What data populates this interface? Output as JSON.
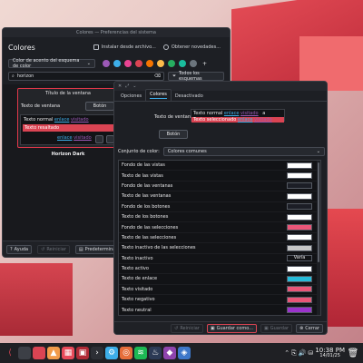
{
  "back_window": {
    "titlebar": "Colores — Preferencias del sistema",
    "title": "Colores",
    "install_label": "Instalar desde archivo...",
    "get_new_label": "Obtener novedades...",
    "accent_combo": "Color de acento del esquema de color",
    "accent_colors": [
      "#9b59b6",
      "#3daee9",
      "#e84393",
      "#da4453",
      "#f67400",
      "#fdbc4b",
      "#27ae60",
      "#1abc9c",
      "#6c757d"
    ],
    "search_value": "horizon",
    "filter_label": "Todos los esquemas",
    "preview": {
      "title": "Título de la ventana",
      "label": "Texto de ventana",
      "button": "Botón",
      "normal_text": "Texto normal",
      "link_text": "enlace",
      "visited_text": "visitado",
      "selected_text": "Texto resaltado",
      "sel_link": "enlace",
      "sel_visited": "visitado"
    },
    "theme_name": "Horizon Dark",
    "bottom": {
      "help": "Ayuda",
      "reset": "Reiniciar",
      "defaults": "Predeterminados"
    }
  },
  "front_window": {
    "tabs": [
      {
        "label": "Opciones"
      },
      {
        "label": "Colores"
      },
      {
        "label": "Desactivado"
      }
    ],
    "preview": {
      "label": "Texto de ventana",
      "normal_text": "Texto normal",
      "link_text": "enlace",
      "visited_text": "visitado",
      "selected_text": "Texto seleccionado",
      "sel_link": "enlace",
      "sel_visited": "visitado",
      "badge": "a"
    },
    "button": "Botón",
    "colorset_label": "Conjunto de color:",
    "colorset_value": "Colores comunes",
    "rows": [
      {
        "label": "Fondo de las vistas",
        "color": "#ffffff"
      },
      {
        "label": "Texto de las vistas",
        "color": "#ffffff"
      },
      {
        "label": "Fondo de las ventanas",
        "color": "#1c1e26"
      },
      {
        "label": "Texto de las ventanas",
        "color": "#ffffff"
      },
      {
        "label": "Fondo de los botones",
        "color": "#1c1e26"
      },
      {
        "label": "Texto de los botones",
        "color": "#ffffff"
      },
      {
        "label": "Fondo de las selecciones",
        "color": "#e95678"
      },
      {
        "label": "Texto de las selecciones",
        "color": "#ffffff"
      },
      {
        "label": "Texto inactivo de las selecciones",
        "color": "#c7c7c7"
      },
      {
        "label": "Texto inactivo",
        "color": "",
        "text": "Varía"
      },
      {
        "label": "Texto activo",
        "color": "#ffffff"
      },
      {
        "label": "Texto de enlace",
        "color": "#26bbd9"
      },
      {
        "label": "Texto visitado",
        "color": "#e95678"
      },
      {
        "label": "Texto negativo",
        "color": "#e95678"
      },
      {
        "label": "Texto neutral",
        "color": "#9b33cc"
      }
    ],
    "bottom": {
      "reset": "Reiniciar",
      "save_as": "Guardar como...",
      "save": "Guardar",
      "close": "Cerrar"
    }
  },
  "taskbar": {
    "time": "10:38 PM",
    "date": "14/01/25"
  }
}
